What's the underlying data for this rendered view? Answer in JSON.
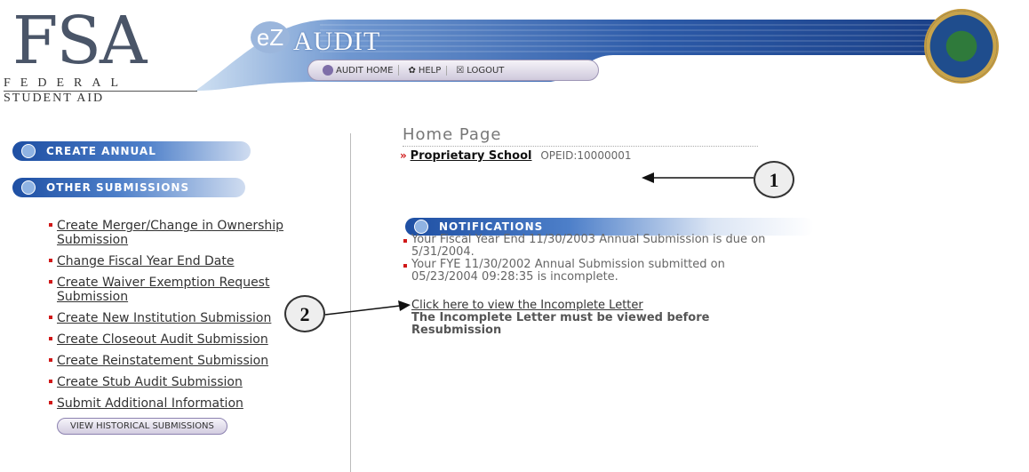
{
  "logo": {
    "big_text": "FSA",
    "line1": "FEDERAL",
    "line2": "STUDENT AID"
  },
  "banner": {
    "title": "AUDIT",
    "prefix": "eZ"
  },
  "nav": {
    "items": [
      {
        "label": "AUDIT HOME",
        "icon": "home-icon"
      },
      {
        "label": "HELP",
        "icon": "help-icon"
      },
      {
        "label": "LOGOUT",
        "icon": "logout-icon"
      }
    ]
  },
  "sidebar": {
    "annual_header": "CREATE ANNUAL SUBMISSIONS",
    "other_header": "OTHER SUBMISSIONS",
    "items": [
      {
        "label": "Create Merger/Change in Ownership Submission"
      },
      {
        "label": "Change Fiscal Year End Date"
      },
      {
        "label": "Create Waiver Exemption Request Submission"
      },
      {
        "label": "Create New Institution Submission"
      },
      {
        "label": "Create Closeout Audit Submission"
      },
      {
        "label": "Create Reinstatement Submission"
      },
      {
        "label": "Create Stub Audit Submission"
      },
      {
        "label": "Submit Additional Information"
      }
    ],
    "historical_button": "VIEW HISTORICAL SUBMISSIONS"
  },
  "main": {
    "page_title": "Home Page",
    "school_name": "Proprietary School",
    "opeid": "OPEID:10000001",
    "notifications_header": "NOTIFICATIONS",
    "notifications": [
      "Your Fiscal Year End 11/30/2003 Annual Submission is due on 5/31/2004.",
      "Your FYE 11/30/2002 Annual Submission submitted on 05/23/2004 09:28:35 is incomplete."
    ],
    "incomplete_link": "Click here to view the Incomplete Letter",
    "incomplete_warning": "The Incomplete Letter must be viewed before Resubmission"
  },
  "callouts": [
    "1",
    "2"
  ]
}
